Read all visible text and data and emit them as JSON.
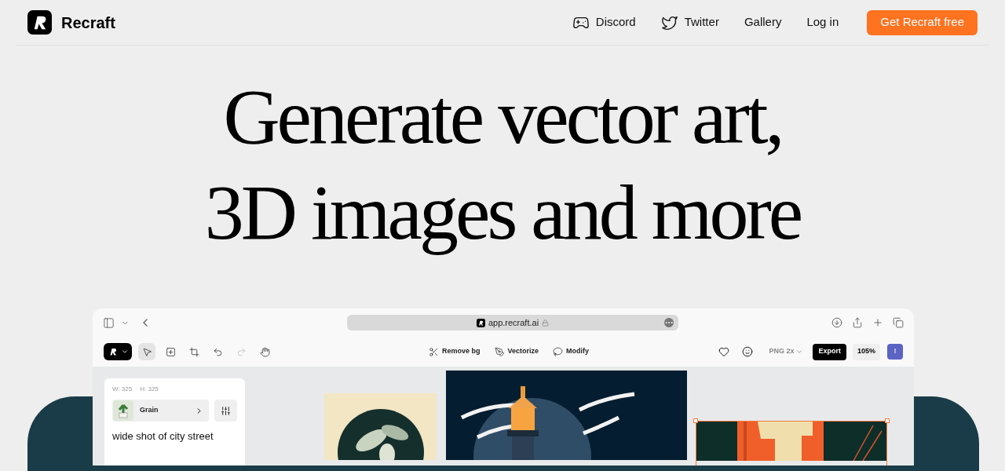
{
  "nav": {
    "brand": "Recraft",
    "links": [
      {
        "kind": "discord",
        "label": "Discord"
      },
      {
        "kind": "twitter",
        "label": "Twitter"
      },
      {
        "kind": "plain",
        "label": "Gallery"
      },
      {
        "kind": "plain",
        "label": "Log in"
      }
    ],
    "cta": "Get Recraft free"
  },
  "headline": [
    "Generate vector art,",
    "3D images and more"
  ],
  "browser": {
    "url": "app.recraft.ai"
  },
  "toolbar": {
    "tools": [
      {
        "kind": "select",
        "selected": true
      },
      {
        "kind": "frame",
        "selected": false
      },
      {
        "kind": "crop",
        "selected": false
      },
      {
        "kind": "undo",
        "selected": false
      },
      {
        "kind": "redo",
        "selected": false
      },
      {
        "kind": "hand",
        "selected": false
      }
    ],
    "actions": [
      {
        "kind": "remove",
        "label": "Remove bg"
      },
      {
        "kind": "vectorize",
        "label": "Vectorize"
      },
      {
        "kind": "modify",
        "label": "Modify"
      }
    ],
    "format": "PNG 2x",
    "export": "Export",
    "zoom": "105%",
    "avatar": "I"
  },
  "panel": {
    "width": "W: 325",
    "height": "H: 325",
    "style": "Grain",
    "prompt": "wide shot of city street"
  }
}
